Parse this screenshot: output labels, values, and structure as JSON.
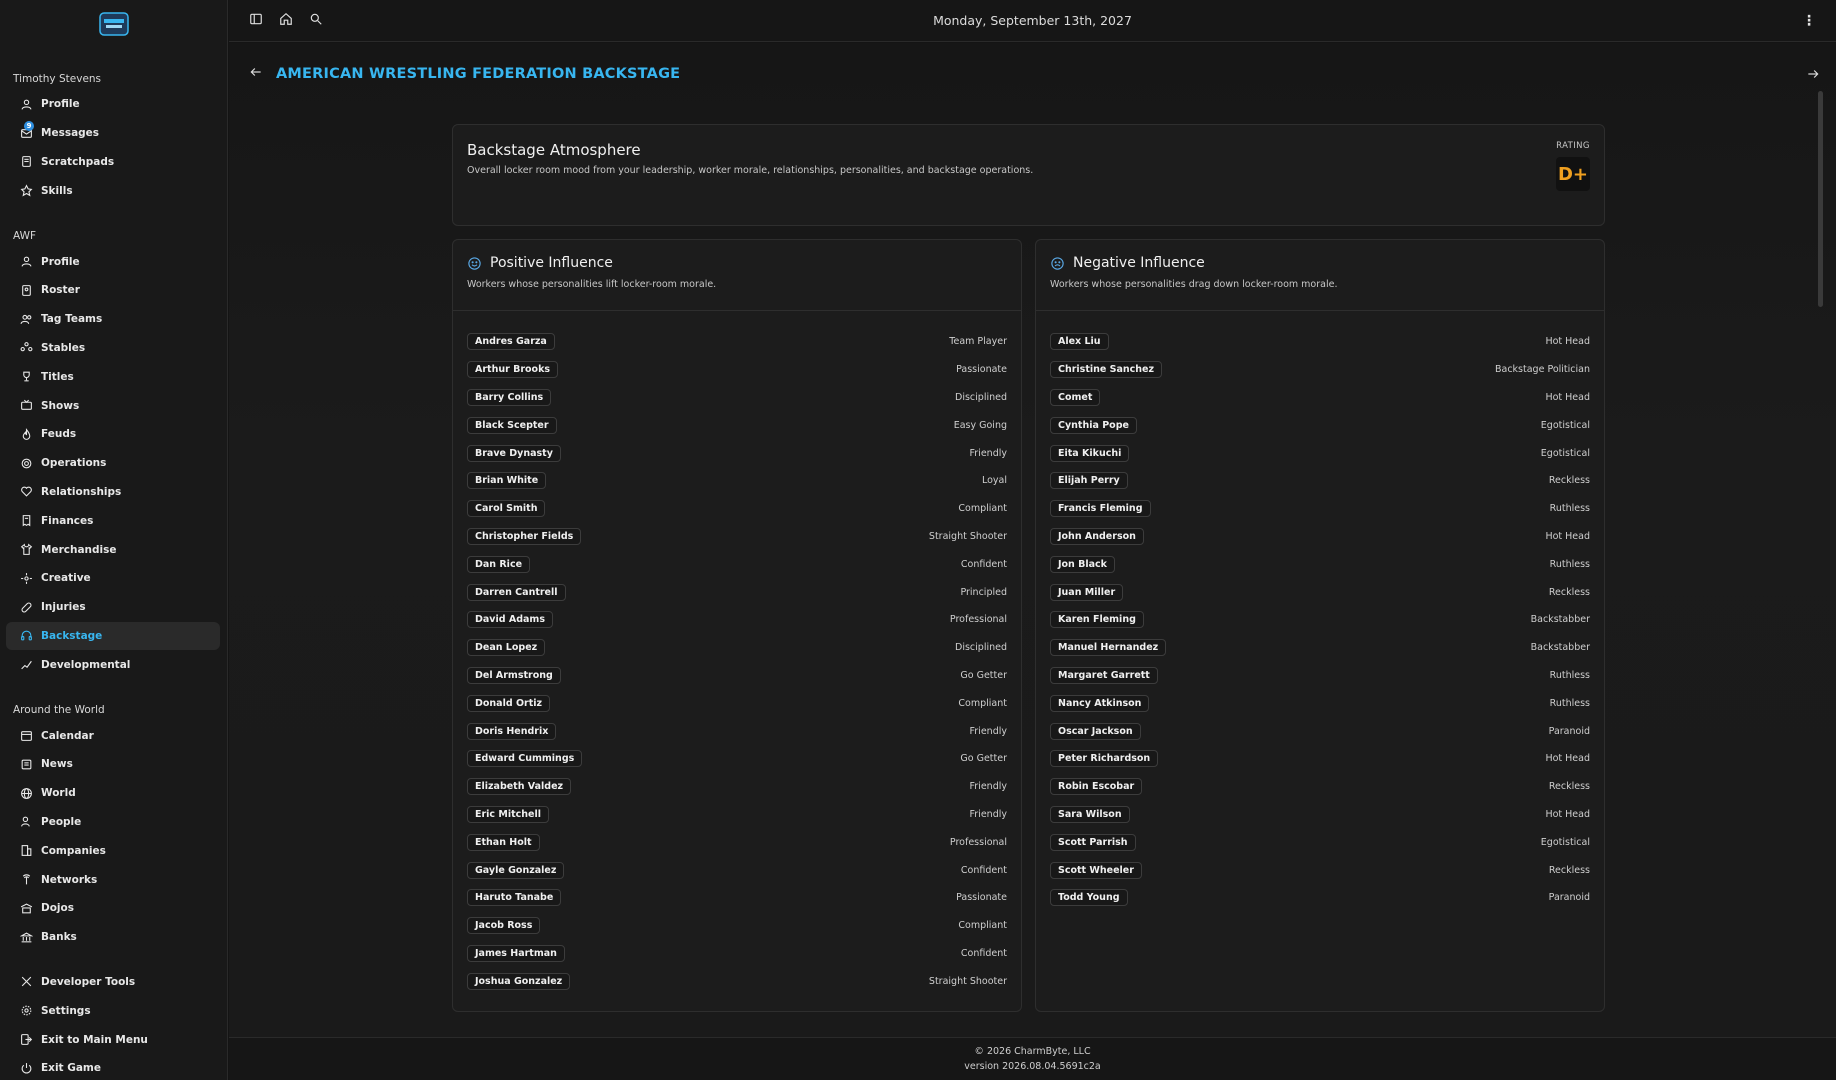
{
  "app": {
    "date": "Monday, September 13th, 2027"
  },
  "sidebar": {
    "user_section": {
      "title": "Timothy Stevens",
      "items": [
        {
          "label": "Profile",
          "icon": "user-icon"
        },
        {
          "label": "Messages",
          "icon": "messages-icon",
          "badge": "9"
        },
        {
          "label": "Scratchpads",
          "icon": "notepad-icon"
        },
        {
          "label": "Skills",
          "icon": "star-icon"
        }
      ]
    },
    "company_section": {
      "title": "AWF",
      "items": [
        {
          "label": "Profile",
          "icon": "user-icon"
        },
        {
          "label": "Roster",
          "icon": "roster-icon"
        },
        {
          "label": "Tag Teams",
          "icon": "users-icon"
        },
        {
          "label": "Stables",
          "icon": "group-icon"
        },
        {
          "label": "Titles",
          "icon": "trophy-icon"
        },
        {
          "label": "Shows",
          "icon": "tv-icon"
        },
        {
          "label": "Feuds",
          "icon": "flame-icon"
        },
        {
          "label": "Operations",
          "icon": "cog-icon"
        },
        {
          "label": "Relationships",
          "icon": "heart-icon"
        },
        {
          "label": "Finances",
          "icon": "receipt-icon"
        },
        {
          "label": "Merchandise",
          "icon": "shirt-icon"
        },
        {
          "label": "Creative",
          "icon": "sparkle-icon"
        },
        {
          "label": "Injuries",
          "icon": "bandage-icon"
        },
        {
          "label": "Backstage",
          "icon": "headphones-icon",
          "active": true
        },
        {
          "label": "Developmental",
          "icon": "chart-icon"
        }
      ]
    },
    "world_section": {
      "title": "Around the World",
      "items": [
        {
          "label": "Calendar",
          "icon": "calendar-icon"
        },
        {
          "label": "News",
          "icon": "news-icon"
        },
        {
          "label": "World",
          "icon": "globe-icon"
        },
        {
          "label": "People",
          "icon": "person-icon"
        },
        {
          "label": "Companies",
          "icon": "building-icon"
        },
        {
          "label": "Networks",
          "icon": "antenna-icon"
        },
        {
          "label": "Dojos",
          "icon": "dojo-icon"
        },
        {
          "label": "Banks",
          "icon": "bank-icon"
        }
      ]
    },
    "bottom_items": [
      {
        "label": "Developer Tools",
        "icon": "tools-icon"
      },
      {
        "label": "Settings",
        "icon": "settings-icon"
      },
      {
        "label": "Exit to Main Menu",
        "icon": "exit-menu-icon"
      },
      {
        "label": "Exit Game",
        "icon": "power-icon"
      }
    ]
  },
  "page": {
    "title": "AMERICAN WRESTLING FEDERATION BACKSTAGE",
    "atmosphere": {
      "title": "Backstage Atmosphere",
      "description": "Overall locker room mood from your leadership, worker morale, relationships, personalities, and backstage operations.",
      "rating_label": "RATING",
      "rating_value": "D+",
      "rating_color": "#f0a020"
    },
    "positive": {
      "title": "Positive Influence",
      "description": "Workers whose personalities lift locker-room morale.",
      "workers": [
        {
          "name": "Andres Garza",
          "trait": "Team Player"
        },
        {
          "name": "Arthur Brooks",
          "trait": "Passionate"
        },
        {
          "name": "Barry Collins",
          "trait": "Disciplined"
        },
        {
          "name": "Black Scepter",
          "trait": "Easy Going"
        },
        {
          "name": "Brave Dynasty",
          "trait": "Friendly"
        },
        {
          "name": "Brian White",
          "trait": "Loyal"
        },
        {
          "name": "Carol Smith",
          "trait": "Compliant"
        },
        {
          "name": "Christopher Fields",
          "trait": "Straight Shooter"
        },
        {
          "name": "Dan Rice",
          "trait": "Confident"
        },
        {
          "name": "Darren Cantrell",
          "trait": "Principled"
        },
        {
          "name": "David Adams",
          "trait": "Professional"
        },
        {
          "name": "Dean Lopez",
          "trait": "Disciplined"
        },
        {
          "name": "Del Armstrong",
          "trait": "Go Getter"
        },
        {
          "name": "Donald Ortiz",
          "trait": "Compliant"
        },
        {
          "name": "Doris Hendrix",
          "trait": "Friendly"
        },
        {
          "name": "Edward Cummings",
          "trait": "Go Getter"
        },
        {
          "name": "Elizabeth Valdez",
          "trait": "Friendly"
        },
        {
          "name": "Eric Mitchell",
          "trait": "Friendly"
        },
        {
          "name": "Ethan Holt",
          "trait": "Professional"
        },
        {
          "name": "Gayle Gonzalez",
          "trait": "Confident"
        },
        {
          "name": "Haruto Tanabe",
          "trait": "Passionate"
        },
        {
          "name": "Jacob Ross",
          "trait": "Compliant"
        },
        {
          "name": "James Hartman",
          "trait": "Confident"
        },
        {
          "name": "Joshua Gonzalez",
          "trait": "Straight Shooter"
        }
      ]
    },
    "negative": {
      "title": "Negative Influence",
      "description": "Workers whose personalities drag down locker-room morale.",
      "workers": [
        {
          "name": "Alex Liu",
          "trait": "Hot Head"
        },
        {
          "name": "Christine Sanchez",
          "trait": "Backstage Politician"
        },
        {
          "name": "Comet",
          "trait": "Hot Head"
        },
        {
          "name": "Cynthia Pope",
          "trait": "Egotistical"
        },
        {
          "name": "Eita Kikuchi",
          "trait": "Egotistical"
        },
        {
          "name": "Elijah Perry",
          "trait": "Reckless"
        },
        {
          "name": "Francis Fleming",
          "trait": "Ruthless"
        },
        {
          "name": "John Anderson",
          "trait": "Hot Head"
        },
        {
          "name": "Jon Black",
          "trait": "Ruthless"
        },
        {
          "name": "Juan Miller",
          "trait": "Reckless"
        },
        {
          "name": "Karen Fleming",
          "trait": "Backstabber"
        },
        {
          "name": "Manuel Hernandez",
          "trait": "Backstabber"
        },
        {
          "name": "Margaret Garrett",
          "trait": "Ruthless"
        },
        {
          "name": "Nancy Atkinson",
          "trait": "Ruthless"
        },
        {
          "name": "Oscar Jackson",
          "trait": "Paranoid"
        },
        {
          "name": "Peter Richardson",
          "trait": "Hot Head"
        },
        {
          "name": "Robin Escobar",
          "trait": "Reckless"
        },
        {
          "name": "Sara Wilson",
          "trait": "Hot Head"
        },
        {
          "name": "Scott Parrish",
          "trait": "Egotistical"
        },
        {
          "name": "Scott Wheeler",
          "trait": "Reckless"
        },
        {
          "name": "Todd Young",
          "trait": "Paranoid"
        }
      ]
    }
  },
  "footer": {
    "copyright": "© 2026 CharmByte, LLC",
    "version": "version 2026.08.04.5691c2a"
  },
  "colors": {
    "accent": "#38b6f0",
    "background": "#141414"
  }
}
